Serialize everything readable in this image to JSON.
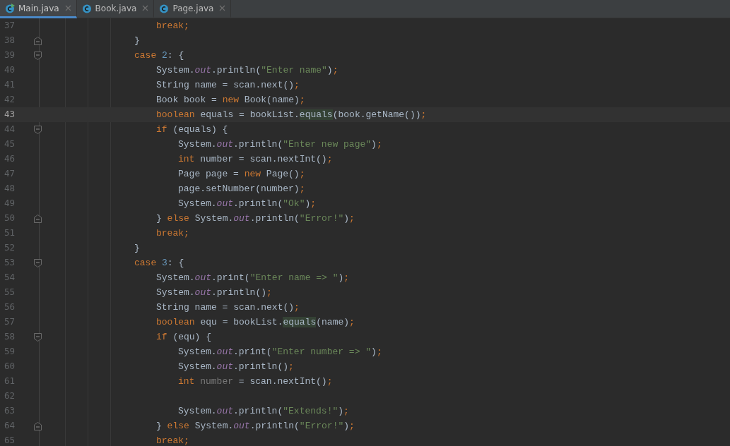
{
  "tabs": [
    {
      "label": "Main.java",
      "selected": true,
      "runnable": true
    },
    {
      "label": "Book.java",
      "selected": false,
      "runnable": false
    },
    {
      "label": "Page.java",
      "selected": false,
      "runnable": false
    }
  ],
  "editor": {
    "lines": [
      {
        "number": "37",
        "current": false,
        "kind": "case",
        "tokens": [
          {
            "kind": "keyword",
            "text": "break;"
          }
        ]
      },
      {
        "number": "38",
        "current": false,
        "fold_end": true,
        "kind": "switch",
        "tokens": [
          {
            "kind": "plain",
            "text": "}"
          }
        ]
      },
      {
        "number": "39",
        "current": false,
        "fold_start": true,
        "kind": "switch",
        "tokens": [
          {
            "kind": "keyword",
            "text": "case "
          },
          {
            "kind": "number",
            "text": "2"
          },
          {
            "kind": "plain",
            "text": ": {"
          }
        ]
      },
      {
        "number": "40",
        "current": false,
        "kind": "case",
        "tokens": [
          {
            "kind": "plain",
            "text": "System."
          },
          {
            "kind": "field",
            "text": "out"
          },
          {
            "kind": "plain",
            "text": ".println("
          },
          {
            "kind": "string",
            "text": "\"Enter name\""
          },
          {
            "kind": "plain",
            "text": ")"
          },
          {
            "kind": "keyword",
            "text": ";"
          }
        ]
      },
      {
        "number": "41",
        "current": false,
        "kind": "case",
        "tokens": [
          {
            "kind": "plain",
            "text": "String name = scan.next()"
          },
          {
            "kind": "keyword",
            "text": ";"
          }
        ]
      },
      {
        "number": "42",
        "current": false,
        "kind": "case",
        "tokens": [
          {
            "kind": "plain",
            "text": "Book book = "
          },
          {
            "kind": "keyword",
            "text": "new "
          },
          {
            "kind": "plain",
            "text": "Book(name)"
          },
          {
            "kind": "keyword",
            "text": ";"
          }
        ]
      },
      {
        "number": "43",
        "current": true,
        "kind": "case",
        "tokens": [
          {
            "kind": "keyword",
            "text": "boolean "
          },
          {
            "kind": "plain",
            "text": "equals = bookList."
          },
          {
            "kind": "match",
            "text": "equals"
          },
          {
            "kind": "plain",
            "text": "(book.getName())"
          },
          {
            "kind": "keyword",
            "text": ";"
          }
        ]
      },
      {
        "number": "44",
        "current": false,
        "fold_start": true,
        "kind": "case",
        "tokens": [
          {
            "kind": "keyword",
            "text": "if "
          },
          {
            "kind": "plain",
            "text": "(equals) {"
          }
        ]
      },
      {
        "number": "45",
        "current": false,
        "kind": "if",
        "tokens": [
          {
            "kind": "plain",
            "text": "System."
          },
          {
            "kind": "field",
            "text": "out"
          },
          {
            "kind": "plain",
            "text": ".println("
          },
          {
            "kind": "string",
            "text": "\"Enter new page\""
          },
          {
            "kind": "plain",
            "text": ")"
          },
          {
            "kind": "keyword",
            "text": ";"
          }
        ]
      },
      {
        "number": "46",
        "current": false,
        "kind": "if",
        "tokens": [
          {
            "kind": "keyword",
            "text": "int "
          },
          {
            "kind": "plain",
            "text": "number = scan.nextInt()"
          },
          {
            "kind": "keyword",
            "text": ";"
          }
        ]
      },
      {
        "number": "47",
        "current": false,
        "kind": "if",
        "tokens": [
          {
            "kind": "plain",
            "text": "Page page = "
          },
          {
            "kind": "keyword",
            "text": "new "
          },
          {
            "kind": "plain",
            "text": "Page()"
          },
          {
            "kind": "keyword",
            "text": ";"
          }
        ]
      },
      {
        "number": "48",
        "current": false,
        "kind": "if",
        "tokens": [
          {
            "kind": "plain",
            "text": "page.setNumber(number)"
          },
          {
            "kind": "keyword",
            "text": ";"
          }
        ]
      },
      {
        "number": "49",
        "current": false,
        "kind": "if",
        "tokens": [
          {
            "kind": "plain",
            "text": "System."
          },
          {
            "kind": "field",
            "text": "out"
          },
          {
            "kind": "plain",
            "text": ".println("
          },
          {
            "kind": "string",
            "text": "\"Ok\""
          },
          {
            "kind": "plain",
            "text": ")"
          },
          {
            "kind": "keyword",
            "text": ";"
          }
        ]
      },
      {
        "number": "50",
        "current": false,
        "fold_end": true,
        "kind": "case",
        "tokens": [
          {
            "kind": "plain",
            "text": "} "
          },
          {
            "kind": "keyword",
            "text": "else "
          },
          {
            "kind": "plain",
            "text": "System."
          },
          {
            "kind": "field",
            "text": "out"
          },
          {
            "kind": "plain",
            "text": ".println("
          },
          {
            "kind": "string",
            "text": "\"Error!\""
          },
          {
            "kind": "plain",
            "text": ")"
          },
          {
            "kind": "keyword",
            "text": ";"
          }
        ]
      },
      {
        "number": "51",
        "current": false,
        "kind": "case",
        "tokens": [
          {
            "kind": "keyword",
            "text": "break;"
          }
        ]
      },
      {
        "number": "52",
        "current": false,
        "kind": "switch",
        "tokens": [
          {
            "kind": "plain",
            "text": "}"
          }
        ]
      },
      {
        "number": "53",
        "current": false,
        "fold_start": true,
        "kind": "switch",
        "tokens": [
          {
            "kind": "keyword",
            "text": "case "
          },
          {
            "kind": "number",
            "text": "3"
          },
          {
            "kind": "plain",
            "text": ": {"
          }
        ]
      },
      {
        "number": "54",
        "current": false,
        "kind": "case",
        "tokens": [
          {
            "kind": "plain",
            "text": "System."
          },
          {
            "kind": "field",
            "text": "out"
          },
          {
            "kind": "plain",
            "text": ".print("
          },
          {
            "kind": "string",
            "text": "\"Enter name => \""
          },
          {
            "kind": "plain",
            "text": ")"
          },
          {
            "kind": "keyword",
            "text": ";"
          }
        ]
      },
      {
        "number": "55",
        "current": false,
        "kind": "case",
        "tokens": [
          {
            "kind": "plain",
            "text": "System."
          },
          {
            "kind": "field",
            "text": "out"
          },
          {
            "kind": "plain",
            "text": ".println()"
          },
          {
            "kind": "keyword",
            "text": ";"
          }
        ]
      },
      {
        "number": "56",
        "current": false,
        "kind": "case",
        "tokens": [
          {
            "kind": "plain",
            "text": "String name = scan.next()"
          },
          {
            "kind": "keyword",
            "text": ";"
          }
        ]
      },
      {
        "number": "57",
        "current": false,
        "kind": "case",
        "tokens": [
          {
            "kind": "keyword",
            "text": "boolean "
          },
          {
            "kind": "plain",
            "text": "equ = bookList."
          },
          {
            "kind": "match",
            "text": "equals"
          },
          {
            "kind": "plain",
            "text": "(name)"
          },
          {
            "kind": "keyword",
            "text": ";"
          }
        ]
      },
      {
        "number": "58",
        "current": false,
        "fold_start": true,
        "kind": "case",
        "tokens": [
          {
            "kind": "keyword",
            "text": "if "
          },
          {
            "kind": "plain",
            "text": "(equ) {"
          }
        ]
      },
      {
        "number": "59",
        "current": false,
        "kind": "if",
        "tokens": [
          {
            "kind": "plain",
            "text": "System."
          },
          {
            "kind": "field",
            "text": "out"
          },
          {
            "kind": "plain",
            "text": ".print("
          },
          {
            "kind": "string",
            "text": "\"Enter number => \""
          },
          {
            "kind": "plain",
            "text": ")"
          },
          {
            "kind": "keyword",
            "text": ";"
          }
        ]
      },
      {
        "number": "60",
        "current": false,
        "kind": "if",
        "tokens": [
          {
            "kind": "plain",
            "text": "System."
          },
          {
            "kind": "field",
            "text": "out"
          },
          {
            "kind": "plain",
            "text": ".println()"
          },
          {
            "kind": "keyword",
            "text": ";"
          }
        ]
      },
      {
        "number": "61",
        "current": false,
        "kind": "if",
        "tokens": [
          {
            "kind": "keyword",
            "text": "int "
          },
          {
            "kind": "unused",
            "text": "number"
          },
          {
            "kind": "plain",
            "text": " = scan.nextInt()"
          },
          {
            "kind": "keyword",
            "text": ";"
          }
        ]
      },
      {
        "number": "62",
        "current": false
      },
      {
        "number": "63",
        "current": false,
        "kind": "if",
        "tokens": [
          {
            "kind": "plain",
            "text": "System."
          },
          {
            "kind": "field",
            "text": "out"
          },
          {
            "kind": "plain",
            "text": ".println("
          },
          {
            "kind": "string",
            "text": "\"Extends!\""
          },
          {
            "kind": "plain",
            "text": ")"
          },
          {
            "kind": "keyword",
            "text": ";"
          }
        ]
      },
      {
        "number": "64",
        "current": false,
        "fold_end": true,
        "kind": "case",
        "tokens": [
          {
            "kind": "plain",
            "text": "} "
          },
          {
            "kind": "keyword",
            "text": "else "
          },
          {
            "kind": "plain",
            "text": "System."
          },
          {
            "kind": "field",
            "text": "out"
          },
          {
            "kind": "plain",
            "text": ".println("
          },
          {
            "kind": "string",
            "text": "\"Error!\""
          },
          {
            "kind": "plain",
            "text": ")"
          },
          {
            "kind": "keyword",
            "text": ";"
          }
        ]
      },
      {
        "number": "65",
        "current": false,
        "kind": "case",
        "tokens": [
          {
            "kind": "keyword",
            "text": "break;"
          }
        ]
      }
    ]
  }
}
